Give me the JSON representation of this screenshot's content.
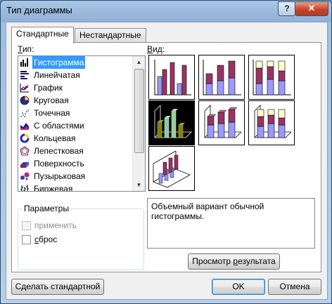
{
  "window": {
    "title": "Тип диаграммы",
    "help_label": "?",
    "close_label": "✕"
  },
  "tabs": [
    {
      "label": "Стандартные",
      "active": true
    },
    {
      "label": "Нестандартные",
      "active": false
    }
  ],
  "type_panel": {
    "label_prefix": "Т",
    "label_rest": "ип:",
    "items": [
      {
        "label": "Гистограмма",
        "icon": "column-chart-icon",
        "selected": true
      },
      {
        "label": "Линейчатая",
        "icon": "bar-chart-icon"
      },
      {
        "label": "График",
        "icon": "line-chart-icon"
      },
      {
        "label": "Круговая",
        "icon": "pie-chart-icon"
      },
      {
        "label": "Точечная",
        "icon": "scatter-chart-icon"
      },
      {
        "label": "С областями",
        "icon": "area-chart-icon"
      },
      {
        "label": "Кольцевая",
        "icon": "doughnut-chart-icon"
      },
      {
        "label": "Лепестковая",
        "icon": "radar-chart-icon"
      },
      {
        "label": "Поверхность",
        "icon": "surface-chart-icon"
      },
      {
        "label": "Пузырьковая",
        "icon": "bubble-chart-icon"
      },
      {
        "label": "Биржевая",
        "icon": "stock-chart-icon"
      }
    ]
  },
  "params": {
    "title": "Параметры",
    "apply_label": "применить",
    "reset_prefix": "с",
    "reset_rest": "брос"
  },
  "view_panel": {
    "label_prefix": "В",
    "label_rest": "ид:",
    "subtypes": [
      {
        "name": "clustered-column"
      },
      {
        "name": "stacked-column"
      },
      {
        "name": "100-stacked-column"
      },
      {
        "name": "3d-clustered-column",
        "selected": true
      },
      {
        "name": "3d-stacked-column"
      },
      {
        "name": "3d-100-stacked-column"
      },
      {
        "name": "3d-column"
      }
    ],
    "description": "Объемный вариант обычной гистограммы."
  },
  "buttons": {
    "preview_prefix": "Просмотр ",
    "preview_accel": "р",
    "preview_rest": "езультата",
    "make_default_prefix": "Сделать стан",
    "make_default_accel": "д",
    "make_default_rest": "артной",
    "ok": "OK",
    "cancel": "Отмена"
  },
  "colors": {
    "title_bar": "#a9c6e4",
    "close_button": "#c7442a",
    "selection": "#3399ff",
    "series_purple": "#993366",
    "series_lavender": "#9999ff",
    "series_cream": "#ffffcc"
  }
}
